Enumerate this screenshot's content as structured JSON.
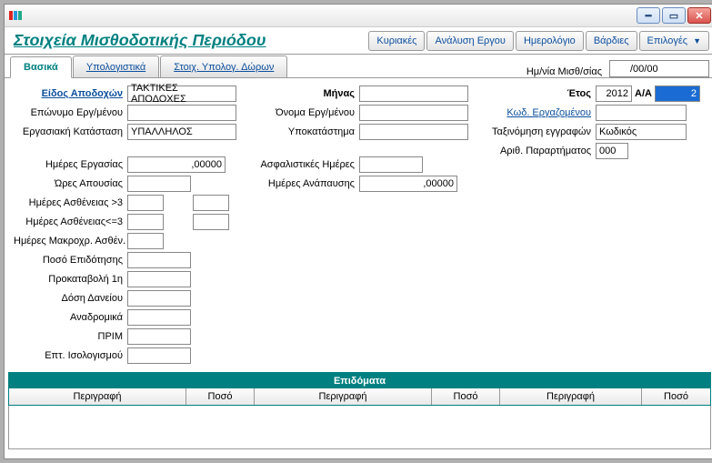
{
  "title": "Στοιχεία Μισθοδοτικής Περιόδου",
  "buttons": {
    "sundays": "Κυριακές",
    "project_analysis": "Ανάλυση Εργου",
    "calendar": "Ημερολόγιο",
    "shifts": "Βάρδιες",
    "options": "Επιλογές"
  },
  "tabs": {
    "basic": "Βασικά",
    "computational": "Υπολογιστικά",
    "gift_calc": "Στοιχ. Υπολογ. Δώρων"
  },
  "payroll_date": {
    "label": "Ημ/νία Μισθ/σίας",
    "value": "/00/00"
  },
  "labels": {
    "earning_type": "Είδος Αποδοχών",
    "surname": "Επώνυμο Εργ/μένου",
    "work_status": "Εργασιακή Κατάσταση",
    "month": "Μήνας",
    "name": "Όνομα Εργ/μένου",
    "branch": "Υποκατάστημα",
    "year": "Έτος",
    "aa": "Α/Α",
    "employee_code": "Κωδ. Εργαζομένου",
    "record_sort": "Ταξινόμηση εγγραφών",
    "appendix_no": "Αριθ. Παραρτήματος",
    "work_days": "Ημέρες Εργασίας",
    "absence_hours": "Ώρες Απουσίας",
    "insurance_days": "Ασφαλιστικές Ημέρες",
    "rest_days": "Ημέρες Ανάπαυσης",
    "sick_gt3": "Ημέρες Ασθένειας >3",
    "sick_le3": "Ημέρες Ασθένειας<=3",
    "long_sick": "Ημέρες Μακροχρ. Ασθέν.",
    "subsidy_amount": "Ποσό Επιδότησης",
    "advance1": "Προκαταβολή 1η",
    "loan_inst": "Δόση Δανείου",
    "retro": "Αναδρομικά",
    "prim": "ΠΡΙΜ",
    "balance_adj": "Επτ. Ισολογισμού"
  },
  "values": {
    "earning_type": "ΤΑΚΤΙΚΕΣ ΑΠΟΔΟΧΕΣ",
    "work_status": "ΥΠΑΛΛΗΛΟΣ",
    "year": "2012",
    "aa": "2",
    "record_sort": "Κωδικός",
    "appendix_no": "000",
    "work_days": ",00000",
    "rest_days": ",00000"
  },
  "epidomata": {
    "title": "Επιδόματα",
    "desc": "Περιγραφή",
    "amount": "Ποσό"
  }
}
